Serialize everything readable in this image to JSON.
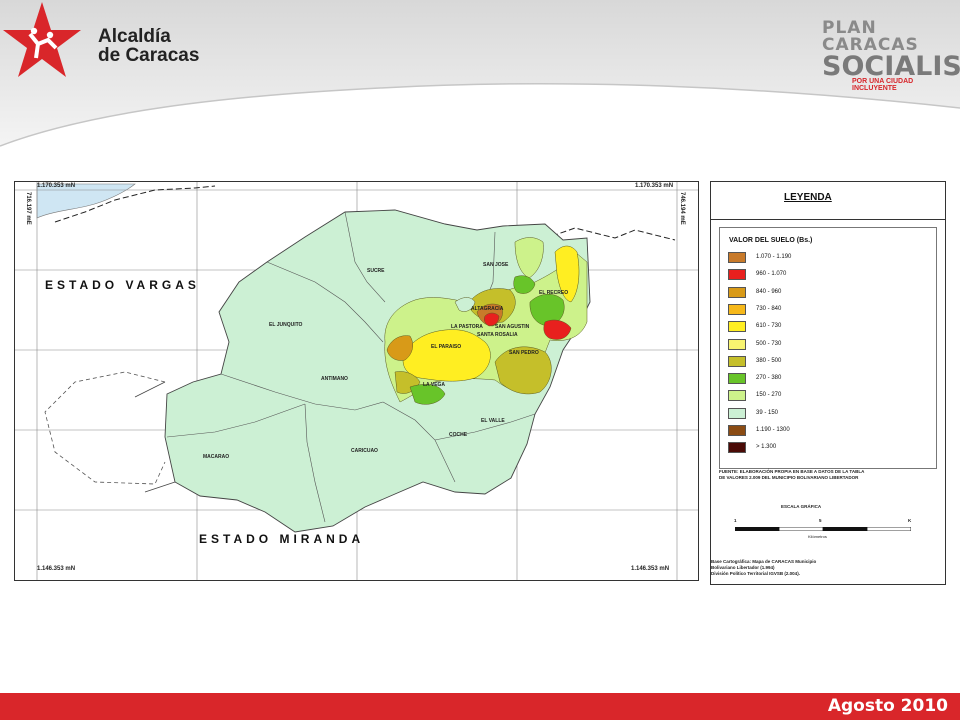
{
  "header": {
    "org_line1": "Alcaldía",
    "org_line2": "de Caracas",
    "plan_line1": "PLAN CARACAS",
    "plan_line2": "SOCIALISTA",
    "plan_line3": "POR UNA CIUDAD INCLUYENTE"
  },
  "map": {
    "coords": {
      "top_left": "1.170.353 mN",
      "top_right": "1.170.353 mN",
      "bottom_left": "1.146.353 mN",
      "bottom_right": "1.146.353 mN",
      "left_vertical": "716.197 mE",
      "right_vertical": "746.194 mE"
    },
    "states": {
      "north": "ESTADO VARGAS",
      "south": "ESTADO MIRANDA"
    },
    "parishes": [
      "SUCRE",
      "EL JUNQUITO",
      "ANTIMANO",
      "MACARAO",
      "CARICUAO",
      "LA VEGA",
      "COCHE",
      "EL VALLE",
      "SAN PEDRO",
      "SAN JOSE",
      "LA PASTORA",
      "EL PARAISO",
      "ALTAGRACIA",
      "SAN AGUSTIN",
      "SANTA ROSALIA",
      "EL RECREO"
    ]
  },
  "legend": {
    "title": "LEYENDA",
    "heading": "VALOR DEL SUELO (Bs.)",
    "items": [
      {
        "label": "1.070 - 1.190",
        "color": "#c87a2a"
      },
      {
        "label": "960 - 1.070",
        "color": "#e8201e"
      },
      {
        "label": "840 - 960",
        "color": "#d89a18"
      },
      {
        "label": "730 - 840",
        "color": "#f6b81a"
      },
      {
        "label": "610 - 730",
        "color": "#ffee22"
      },
      {
        "label": "500 - 730",
        "color": "#f8f470"
      },
      {
        "label": "380 - 500",
        "color": "#c5bf2a"
      },
      {
        "label": "270 - 380",
        "color": "#68c429"
      },
      {
        "label": "150 - 270",
        "color": "#cdf28b"
      },
      {
        "label": "39 - 150",
        "color": "#ccf0d4"
      },
      {
        "label": "1.190 - 1300",
        "color": "#8b4c14"
      },
      {
        "label": "> 1.300",
        "color": "#4a0a06"
      }
    ],
    "source_line1": "FUENTE: ELABORACIÓN PROPIA EN BASE A DATOS DE LA TABLA",
    "source_line2": "DE VALORES 2.009 DEL MUNICIPIO BOLIVARIANO LIBERTADOR",
    "scale_title": "ESCALA GRÁFICA",
    "scale_ticks": [
      "1",
      "5",
      "K"
    ],
    "scale_unit": "Kilómetros",
    "base_line1": "Base Cartográfica: Mapa de CARACAS Municipio",
    "base_line2": "Bolivariano Libertador (1.994)",
    "base_line3": "División Político Territorial IGVSB (2.004)."
  },
  "footer": {
    "date": "Agosto 2010"
  }
}
